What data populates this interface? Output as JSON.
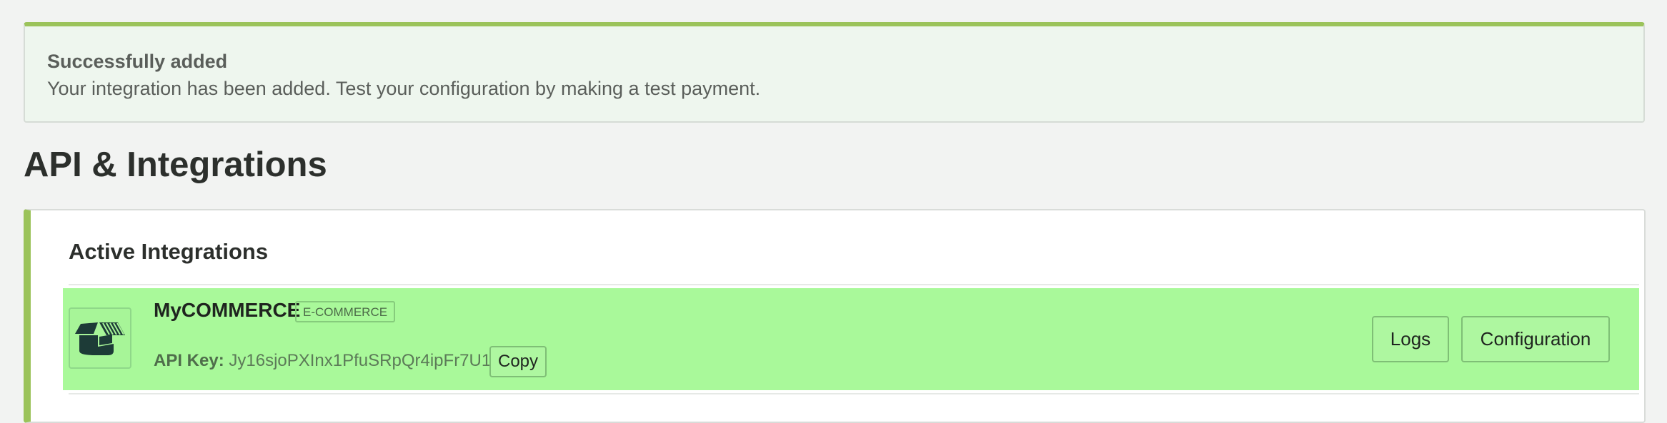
{
  "alert": {
    "title": "Successfully added",
    "message": "Your integration has been added. Test your configuration by making a test payment."
  },
  "page": {
    "title": "API & Integrations"
  },
  "active_integrations": {
    "heading": "Active Integrations",
    "items": [
      {
        "icon": "open-box-icon",
        "name": "MyCOMMERCE",
        "category": "E-COMMERCE",
        "api_key_label": "API Key:",
        "api_key": "Jy16sjoPXInx1PfuSRpQr4ipFr7U1D",
        "copy_label": "Copy",
        "logs_label": "Logs",
        "configuration_label": "Configuration"
      }
    ]
  },
  "colors": {
    "accent": "#9bc35a",
    "row_highlight": "#a9f99a",
    "alert_background": "#eef6ee"
  }
}
